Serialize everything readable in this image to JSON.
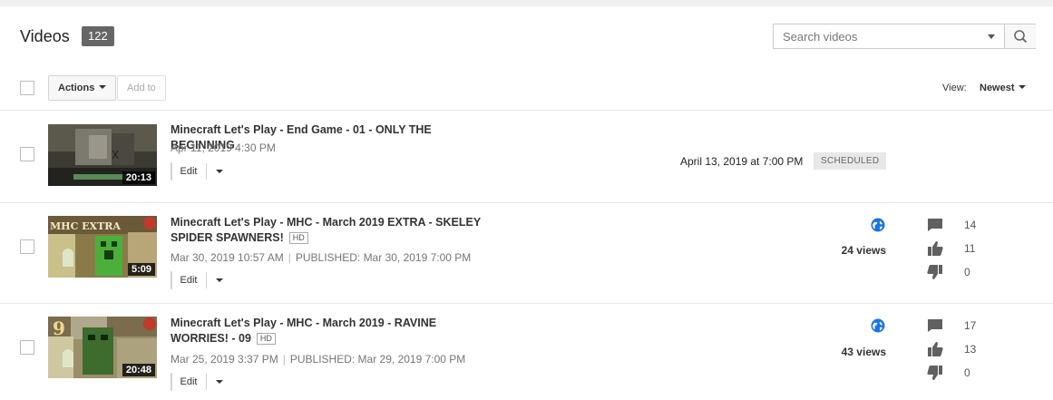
{
  "header": {
    "title": "Videos",
    "count": "122"
  },
  "search": {
    "placeholder": "Search videos",
    "value": ""
  },
  "toolbar": {
    "actions_label": "Actions",
    "add_to_label": "Add to",
    "view_label": "View:",
    "view_value": "Newest"
  },
  "colors": {
    "accent_blue": "#1a73e8",
    "badge_gray": "#666666",
    "icon_gray": "#606060"
  },
  "videos": [
    {
      "title": "Minecraft Let's Play - End Game - 01 - ONLY THE BEGINNING",
      "hd": "",
      "date": "Apr 11, 2019 4:30 PM",
      "published": "",
      "duration": "20:13",
      "edit_label": "Edit",
      "scheduled_date": "April 13, 2019 at 7:00 PM",
      "status": "SCHEDULED"
    },
    {
      "title": "Minecraft Let's Play - MHC - March 2019 EXTRA - SKELEY SPIDER SPAWNERS!",
      "hd": "HD",
      "date": "Mar 30, 2019 10:57 AM",
      "published": "PUBLISHED: Mar 30, 2019 7:00 PM",
      "duration": "5:09",
      "edit_label": "Edit",
      "visibility_icon": "globe-icon",
      "views": "24 views",
      "comments": "14",
      "likes": "11",
      "dislikes": "0",
      "thumb_text": "MHC EXTRA"
    },
    {
      "title": "Minecraft Let's Play - MHC - March 2019 - RAVINE WORRIES! - 09",
      "hd": "HD",
      "date": "Mar 25, 2019 3:37 PM",
      "published": "PUBLISHED: Mar 29, 2019 7:00 PM",
      "duration": "20:48",
      "edit_label": "Edit",
      "visibility_icon": "globe-icon",
      "views": "43 views",
      "comments": "17",
      "likes": "13",
      "dislikes": "0",
      "thumb_text": "9"
    }
  ]
}
